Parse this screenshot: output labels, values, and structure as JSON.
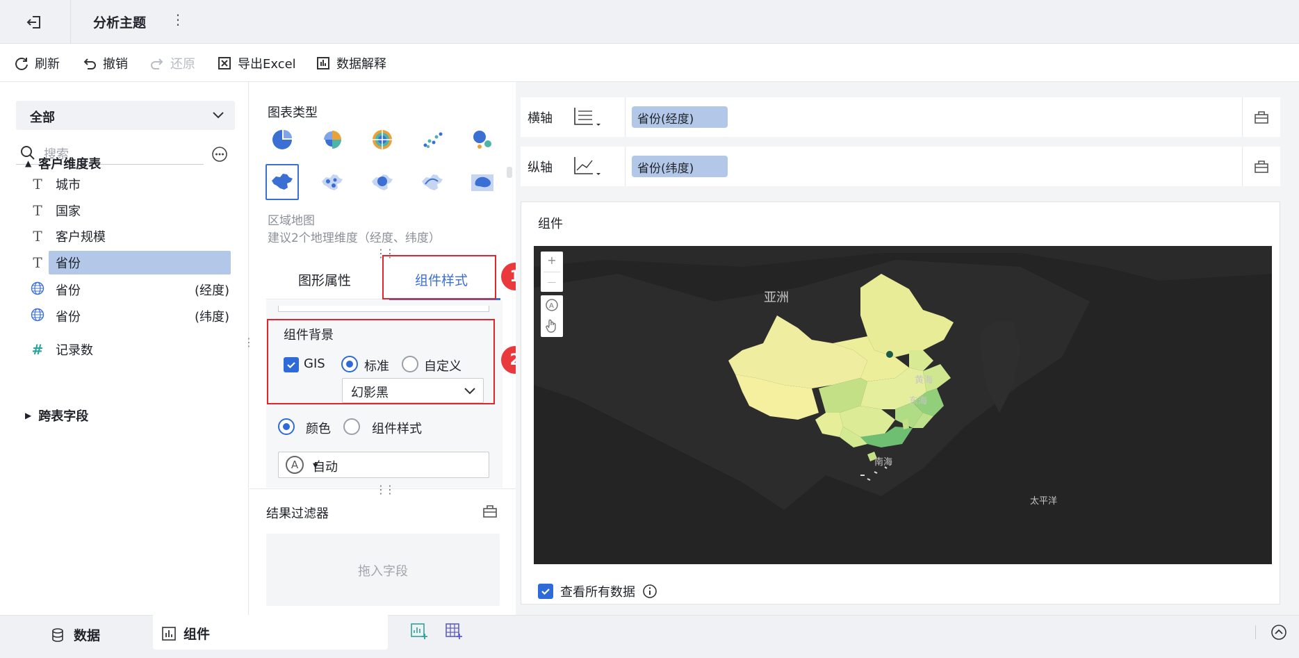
{
  "header": {
    "title": "分析主题"
  },
  "toolbar": {
    "refresh": "刷新",
    "undo": "撤销",
    "redo": "还原",
    "export": "导出Excel",
    "explain": "数据解释"
  },
  "left_panel": {
    "scope": "全部",
    "search_placeholder": "搜索",
    "group_customer": "客户维度表",
    "fields": [
      {
        "name": "城市",
        "icon": "text-type-icon"
      },
      {
        "name": "国家",
        "icon": "text-type-icon"
      },
      {
        "name": "客户规模",
        "icon": "text-type-icon"
      },
      {
        "name": "省份",
        "icon": "text-type-icon",
        "selected": true
      },
      {
        "name": "省份",
        "suffix": "(经度)",
        "icon": "globe-icon"
      },
      {
        "name": "省份",
        "suffix": "(纬度)",
        "icon": "globe-icon"
      },
      {
        "name": "记录数",
        "icon": "measure-icon"
      }
    ],
    "group_cross": "跨表字段"
  },
  "middle_panel": {
    "chart_type_title": "图表类型",
    "caption_title": "区域地图",
    "caption_hint": "建议2个地理维度（经度、纬度）",
    "tabs": [
      "图形属性",
      "组件样式"
    ],
    "active_tab": "组件样式",
    "bg_section": "组件背景",
    "gis_label": "GIS",
    "radio_standard": "标准",
    "radio_custom": "自定义",
    "theme_value": "幻影黑",
    "color_label": "颜色",
    "widget_style_label": "组件样式",
    "auto_label": "自动",
    "result_filter": "结果过滤器",
    "drop_hint": "拖入字段",
    "badges": [
      "1",
      "2"
    ]
  },
  "axes": {
    "x_label": "横轴",
    "x_field": "省份(经度)",
    "y_label": "纵轴",
    "y_field": "省份(纬度)"
  },
  "widget": {
    "title": "组件",
    "map_labels": {
      "asia": "亚洲",
      "yellow_sea": "黄海",
      "east_sea": "东海",
      "south_sea": "南海",
      "pacific": "太平洋"
    },
    "zoom_in": "+",
    "zoom_out": "—",
    "view_all": "查看所有数据"
  },
  "bottom_tabs": {
    "data": "数据",
    "widget": "组件"
  },
  "colors": {
    "accent": "#3b6fd4",
    "selected_bg": "#b3c7e8",
    "annotation_red": "#e3242b",
    "map_bg": "#242424"
  }
}
